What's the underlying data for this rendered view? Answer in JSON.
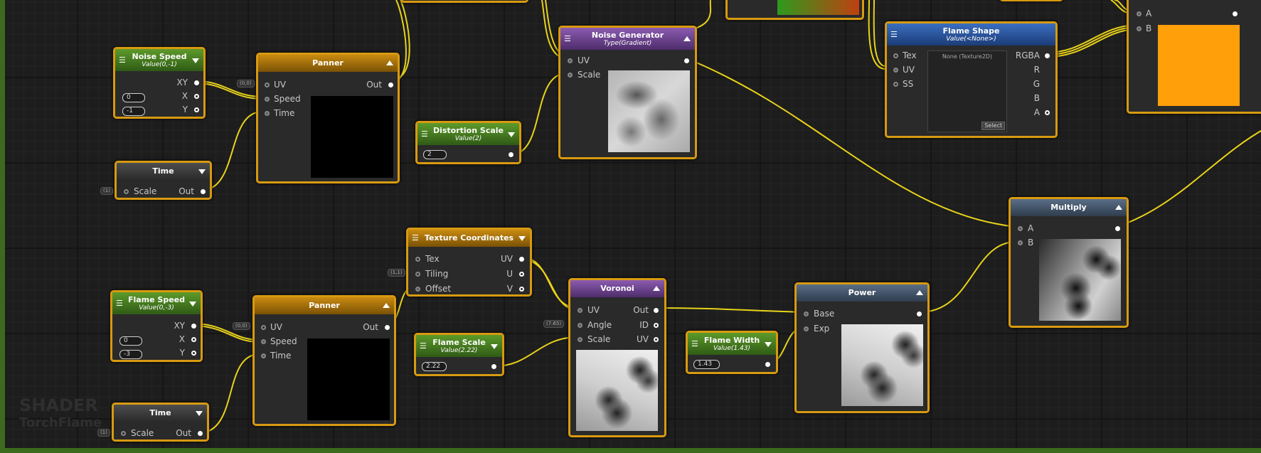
{
  "colors": {
    "wire": "#e8d21a",
    "node_border": "#d89a10",
    "border_green": "#3c6b1e"
  },
  "nodes": {
    "noise_speed": {
      "title": "Noise Speed",
      "subtitle": "Value(0,-1)",
      "out_xy": "XY",
      "x_label": "X",
      "y_label": "Y",
      "x_value": "0",
      "y_value": "-1"
    },
    "panner_top": {
      "title": "Panner",
      "uv": "UV",
      "speed": "Speed",
      "time": "Time",
      "out": "Out",
      "speed_tag": "(0,0)"
    },
    "time_top": {
      "title": "Time",
      "scale": "Scale",
      "out": "Out",
      "scale_tag": "(1)"
    },
    "distortion_scale": {
      "title": "Distortion Scale",
      "subtitle": "Value(2)",
      "value": "2"
    },
    "noise_generator": {
      "title": "Noise Generator",
      "subtitle": "Type(Gradient)",
      "uv": "UV",
      "scale": "Scale"
    },
    "flame_shape": {
      "title": "Flame Shape",
      "subtitle": "Value(<None>)",
      "tex": "Tex",
      "uv": "UV",
      "ss": "SS",
      "rgba": "RGBA",
      "r": "R",
      "g": "G",
      "b": "B",
      "a": "A",
      "texture_label": "None (Texture2D)",
      "select": "Select"
    },
    "multiply": {
      "title": "Multiply",
      "a": "A",
      "b": "B"
    },
    "texture_coordinates": {
      "title": "Texture Coordinates",
      "tex": "Tex",
      "tiling": "Tiling",
      "offset": "Offset",
      "uv": "UV",
      "u": "U",
      "v": "V",
      "tiling_tag": "(1,1)"
    },
    "flame_speed": {
      "title": "Flame Speed",
      "subtitle": "Value(0,-3)",
      "out_xy": "XY",
      "x_label": "X",
      "y_label": "Y",
      "x_value": "0",
      "y_value": "-3"
    },
    "panner_bottom": {
      "title": "Panner",
      "uv": "UV",
      "speed": "Speed",
      "time": "Time",
      "out": "Out",
      "speed_tag": "(0,0)"
    },
    "time_bottom": {
      "title": "Time",
      "scale": "Scale",
      "out": "Out",
      "scale_tag": "(1)"
    },
    "flame_scale": {
      "title": "Flame Scale",
      "subtitle": "Value(2.22)",
      "value": "2.22"
    },
    "voronoi": {
      "title": "Voronoi",
      "uv": "UV",
      "angle": "Angle",
      "scale": "Scale",
      "out": "Out",
      "id": "ID",
      "uv_out": "UV",
      "angle_tag": "(7.65)"
    },
    "flame_width": {
      "title": "Flame Width",
      "subtitle": "Value(1.43)",
      "value": "1.43"
    },
    "power": {
      "title": "Power",
      "base": "Base",
      "exp": "Exp"
    },
    "top_right_node": {
      "a": "A",
      "b": "B"
    }
  },
  "watermark": {
    "line1": "SHADER",
    "line2": "TorchFlame"
  }
}
